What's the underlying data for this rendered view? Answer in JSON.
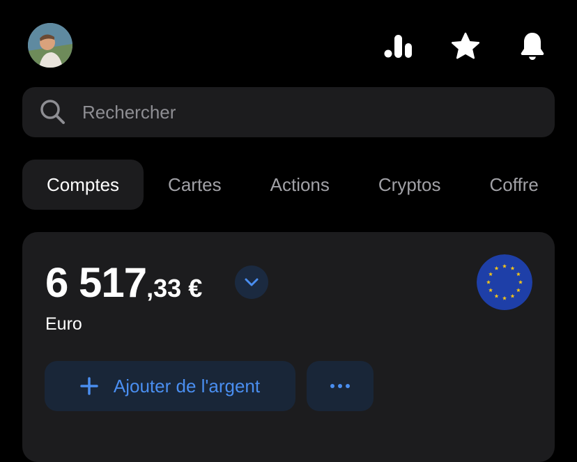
{
  "header": {
    "avatar_icon": "user-avatar",
    "icons": [
      "stats-icon",
      "star-icon",
      "bell-icon"
    ]
  },
  "search": {
    "placeholder": "Rechercher"
  },
  "tabs": [
    {
      "label": "Comptes",
      "active": true
    },
    {
      "label": "Cartes",
      "active": false
    },
    {
      "label": "Actions",
      "active": false
    },
    {
      "label": "Cryptos",
      "active": false
    },
    {
      "label": "Coffre",
      "active": false
    }
  ],
  "account": {
    "balance_integer": "6 517",
    "balance_decimal": ",33",
    "currency_symbol": "€",
    "currency_name": "Euro",
    "flag_icon": "eu-flag-icon",
    "add_money_label": "Ajouter de l'argent",
    "more_label": "···"
  },
  "colors": {
    "background": "#000000",
    "surface": "#1c1c1e",
    "accent": "#4a8ef0",
    "button_bg": "#192638",
    "muted_text": "#a1a1a6"
  }
}
